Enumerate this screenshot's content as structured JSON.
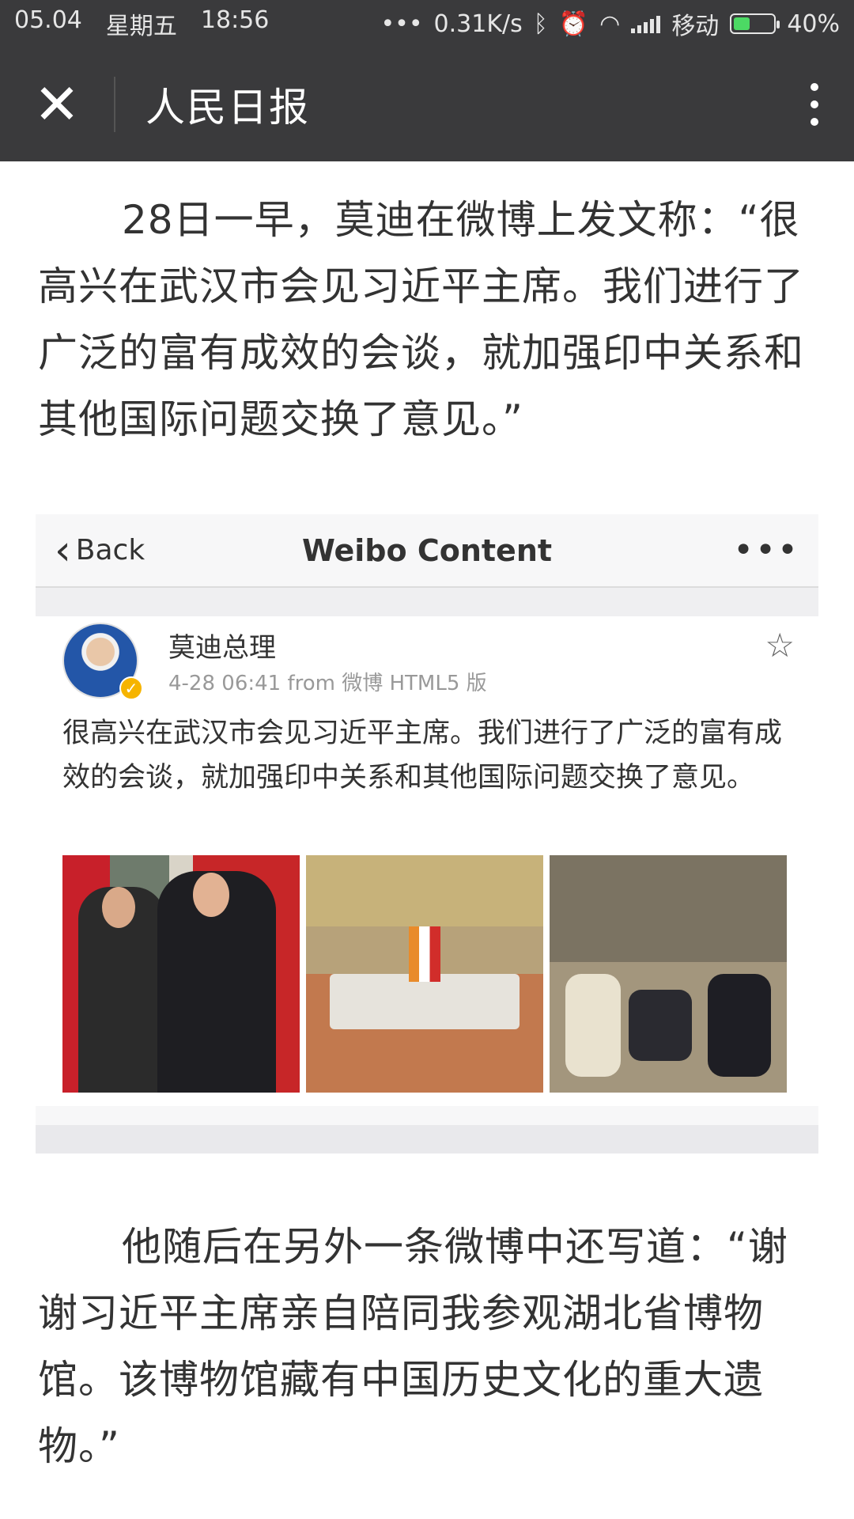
{
  "status_bar": {
    "date": "05.04",
    "weekday": "星期五",
    "time": "18:56",
    "dots": "•••",
    "speed": "0.31K/s",
    "bluetooth_icon": "ᛒ",
    "alarm_icon": "⏰",
    "wifi_icon": "◠",
    "carrier": "移动",
    "battery": "40%",
    "battery_level": 0.4
  },
  "nav": {
    "close_icon": "✕",
    "title": "人民日报"
  },
  "article": {
    "para1": "28日一早，莫迪在微博上发文称：“很高兴在武汉市会见习近平主席。我们进行了广泛的富有成效的会谈，就加强印中关系和其他国际问题交换了意见。”",
    "para2": "他随后在另外一条微博中还写道：“谢谢习近平主席亲自陪同我参观湖北省博物馆。该博物馆藏有中国历史文化的重大遗物。”"
  },
  "embedded": {
    "back_label": "Back",
    "back_icon": "‹",
    "title": "Weibo Content",
    "more_icon": "•••",
    "post": {
      "author": "莫迪总理",
      "meta": "4-28 06:41  from 微博 HTML5 版",
      "star_icon": "☆",
      "verified_icon": "✓",
      "text": "很高兴在武汉市会见习近平主席。我们进行了广泛的富有成效的会谈，就加强印中关系和其他国际问题交换了意见。"
    }
  }
}
